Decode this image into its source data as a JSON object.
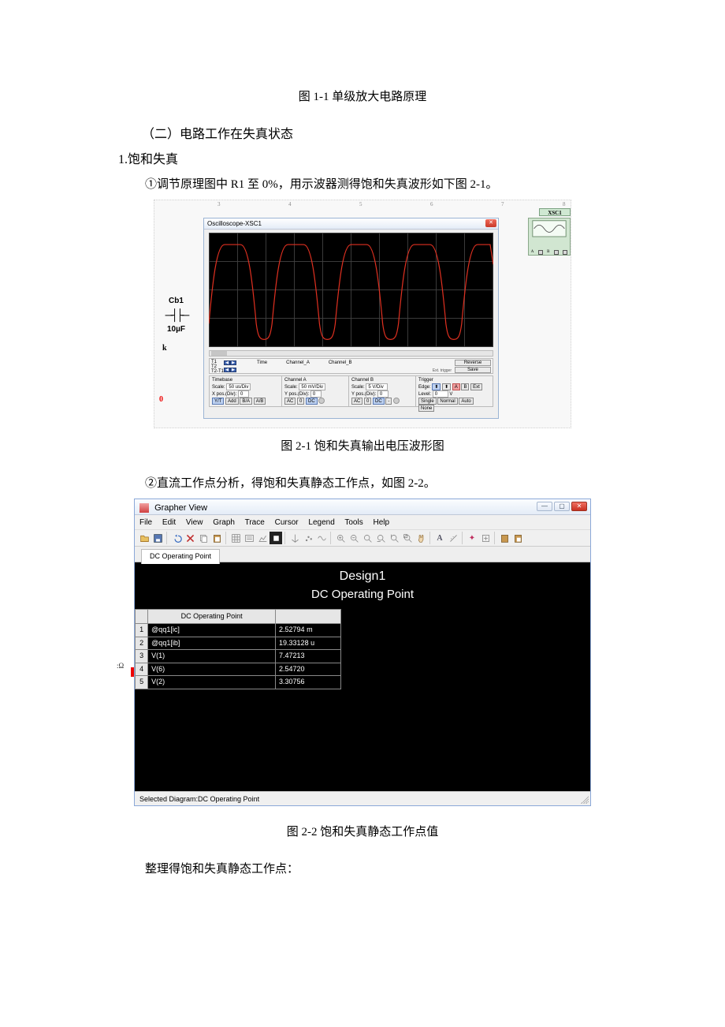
{
  "captions": {
    "fig1_1": "图 1-1 单级放大电路原理",
    "section2": "（二）电路工作在失真状态",
    "sub1": "1.饱和失真",
    "para1": "①调节原理图中 R1 至 0%，用示波器测得饱和失真波形如下图 2-1。",
    "fig2_1": "图 2-1 饱和失真输出电压波形图",
    "para2": "②直流工作点分析，得饱和失真静态工作点，如图 2-2。",
    "fig2_2": "图 2-2 饱和失真静态工作点值",
    "para3": "整理得饱和失真静态工作点："
  },
  "oscilloscope": {
    "title": "Oscilloscope-XSC1",
    "cb1_label": "Cb1",
    "cb1_value": "10µF",
    "zero_label": "0",
    "k_label": "k",
    "readout": {
      "t1": "T1",
      "t2": "T2",
      "t2t1": "T2-T1",
      "time": "Time",
      "chA": "Channel_A",
      "chB": "Channel_B",
      "reverse": "Reverse",
      "save": "Save",
      "ext": "Ext. trigger"
    },
    "timebase": {
      "title": "Timebase",
      "scale_label": "Scale:",
      "scale_val": "50 us/Div",
      "xpos_label": "X pos.(Div):",
      "xpos_val": "0",
      "btns": [
        "Y/T",
        "Add",
        "B/A",
        "A/B"
      ]
    },
    "chanA": {
      "title": "Channel A",
      "scale_label": "Scale:",
      "scale_val": "50 mV/Div",
      "ypos_label": "Y pos.(Div):",
      "ypos_val": "0",
      "btns": [
        "AC",
        "0",
        "DC"
      ]
    },
    "chanB": {
      "title": "Channel B",
      "scale_label": "Scale:",
      "scale_val": "5  V/Div",
      "ypos_label": "Y pos.(Div):",
      "ypos_val": "0",
      "btns": [
        "AC",
        "0",
        "DC",
        "-"
      ]
    },
    "trigger": {
      "title": "Trigger",
      "edge_label": "Edge:",
      "level_label": "Level:",
      "level_val": "0",
      "level_unit": "V",
      "btns": [
        "Single",
        "Normal",
        "Auto",
        "None"
      ],
      "edge_btns": [
        "A",
        "B",
        "Ext"
      ]
    },
    "xsc_tab": "XSC1",
    "xsc_ports": [
      "A",
      "B"
    ]
  },
  "grapher": {
    "title": "Grapher View",
    "menus": [
      "File",
      "Edit",
      "View",
      "Graph",
      "Trace",
      "Cursor",
      "Legend",
      "Tools",
      "Help"
    ],
    "tab_label": "DC Operating Point",
    "chart_title": "Design1",
    "chart_sub": "DC Operating Point",
    "left_edge": ":Ω",
    "col1": "DC Operating Point",
    "status": "Selected Diagram:DC Operating Point"
  },
  "chart_data": {
    "type": "table",
    "columns": [
      "DC Operating Point",
      ""
    ],
    "rows": [
      {
        "idx": "1",
        "name": "@qq1[ic]",
        "value": "2.52794 m"
      },
      {
        "idx": "2",
        "name": "@qq1[ib]",
        "value": "19.33128 u"
      },
      {
        "idx": "3",
        "name": "V(1)",
        "value": "7.47213"
      },
      {
        "idx": "4",
        "name": "V(6)",
        "value": "2.54720"
      },
      {
        "idx": "5",
        "name": "V(2)",
        "value": "3.30756"
      }
    ]
  }
}
